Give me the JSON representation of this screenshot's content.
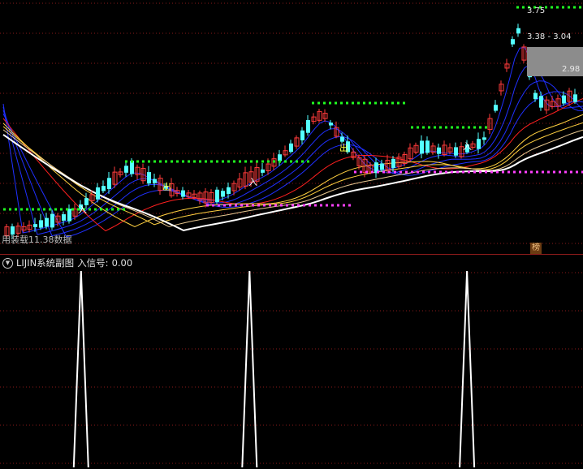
{
  "main_chart": {
    "high_label": "3.75",
    "range_label": "3.38 - 3.04",
    "box_value_label": "2.98",
    "left_caption": "用装载11.38数据",
    "badge_label": "榜",
    "markers": {
      "entry_label": "入",
      "exit_label": "出"
    },
    "colors": {
      "up_candle": "#ff3b3b",
      "down_candle": "#54ffff",
      "ma_blue": "#2030ff",
      "ma_red": "#ff2020",
      "ma_yellow": "#ffd040",
      "ma_white": "#ffffff",
      "support_dots": "#ff40ff",
      "resistance_dots": "#20ff20",
      "grid": "#8a1a1a"
    }
  },
  "sub_chart": {
    "title": "LIJIN系统副图",
    "indicator_label": "入信号:",
    "indicator_value": "0.00",
    "chart_data": {
      "type": "line",
      "series": [
        {
          "name": "入信号",
          "spikes_at_fraction": [
            0.139,
            0.428,
            0.801
          ],
          "values": [
            1,
            1,
            1
          ]
        }
      ],
      "ylim": [
        0,
        1
      ]
    }
  }
}
